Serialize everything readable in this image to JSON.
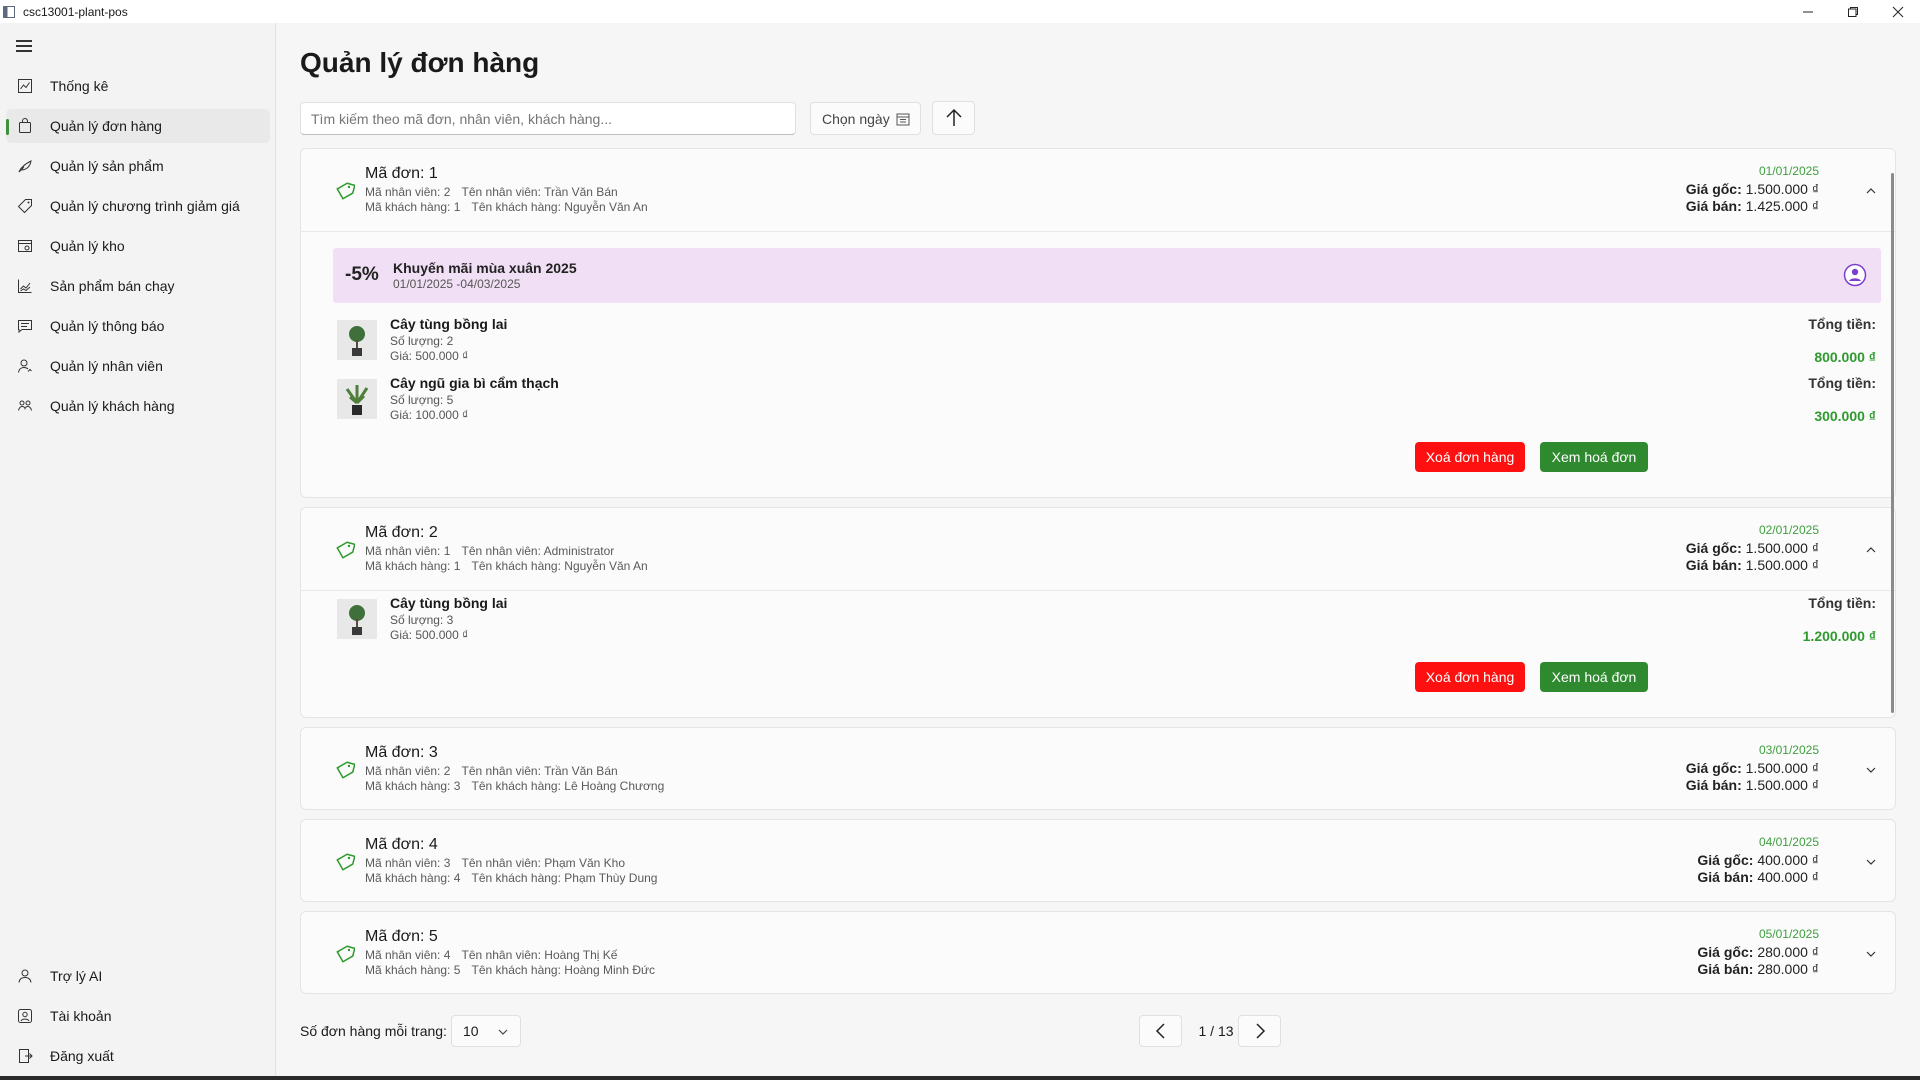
{
  "window": {
    "title": "csc13001-plant-pos"
  },
  "sidebar": {
    "items": [
      {
        "label": "Thống kê",
        "icon": "chart-icon"
      },
      {
        "label": "Quản lý đơn hàng",
        "icon": "shopping-bag-icon"
      },
      {
        "label": "Quản lý sản phẩm",
        "icon": "plant-icon"
      },
      {
        "label": "Quản lý chương trình giảm giá",
        "icon": "tag-icon"
      },
      {
        "label": "Quản lý kho",
        "icon": "warehouse-icon"
      },
      {
        "label": "Sản phẩm bán chạy",
        "icon": "trend-chart-icon"
      },
      {
        "label": "Quản lý thông báo",
        "icon": "message-icon"
      },
      {
        "label": "Quản lý nhân viên",
        "icon": "person-icon"
      },
      {
        "label": "Quản lý khách hàng",
        "icon": "people-icon"
      }
    ],
    "bottom_items": [
      {
        "label": "Trợ lý AI",
        "icon": "bot-icon"
      },
      {
        "label": "Tài khoản",
        "icon": "account-icon"
      },
      {
        "label": "Đăng xuất",
        "icon": "sign-out-icon"
      }
    ],
    "active_item": "Quản lý đơn hàng"
  },
  "main": {
    "title": "Quản lý đơn hàng",
    "search": {
      "placeholder": "Tìm kiếm theo mã đơn, nhân viên, khách hàng..."
    },
    "date_picker": {
      "label": "Chọn ngày"
    },
    "accent_color": "#2f8a2f",
    "danger_color": "#ff1010"
  },
  "labels": {
    "employee_id": "Mã nhân viên:",
    "employee_name": "Tên nhân viên:",
    "customer_id": "Mã khách hàng:",
    "customer_name": "Tên khách hàng:",
    "original_price": "Giá gốc:",
    "sale_price": "Giá bán:",
    "quantity": "Số lượng:",
    "unit_price": "Giá:",
    "total": "Tổng tiền:",
    "delete_order": "Xoá đơn hàng",
    "view_invoice": "Xem hoá đơn"
  },
  "orders": [
    {
      "id_label": "Mã đơn: 1",
      "employee_id": "2",
      "employee_name": "Trần Văn Bán",
      "customer_id": "1",
      "customer_name": "Nguyễn Văn An",
      "date": "01/01/2025",
      "original_price": "1.500.000 ₫",
      "sale_price": "1.425.000 ₫",
      "expanded": true,
      "promotion": {
        "percent": "-5%",
        "name": "Khuyến mãi mùa xuân 2025",
        "dates": "01/01/2025 -04/03/2025"
      },
      "items": [
        {
          "name": "Cây tùng bồng lai",
          "quantity": "2",
          "price": "500.000 ₫",
          "total": "800.000 ₫"
        },
        {
          "name": "Cây ngũ gia bì cẩm thạch",
          "quantity": "5",
          "price": "100.000 ₫",
          "total": "300.000 ₫"
        }
      ]
    },
    {
      "id_label": "Mã đơn: 2",
      "employee_id": "1",
      "employee_name": "Administrator",
      "customer_id": "1",
      "customer_name": "Nguyễn Văn An",
      "date": "02/01/2025",
      "original_price": "1.500.000 ₫",
      "sale_price": "1.500.000 ₫",
      "expanded": true,
      "items": [
        {
          "name": "Cây tùng bồng lai",
          "quantity": "3",
          "price": "500.000 ₫",
          "total": "1.200.000 ₫"
        }
      ]
    },
    {
      "id_label": "Mã đơn: 3",
      "employee_id": "2",
      "employee_name": "Trần Văn Bán",
      "customer_id": "3",
      "customer_name": "Lê Hoàng Chương",
      "date": "03/01/2025",
      "original_price": "1.500.000 ₫",
      "sale_price": "1.500.000 ₫",
      "expanded": false
    },
    {
      "id_label": "Mã đơn: 4",
      "employee_id": "3",
      "employee_name": "Phạm Văn Kho",
      "customer_id": "4",
      "customer_name": "Phạm Thùy Dung",
      "date": "04/01/2025",
      "original_price": "400.000 ₫",
      "sale_price": "400.000 ₫",
      "expanded": false
    },
    {
      "id_label": "Mã đơn: 5",
      "employee_id": "4",
      "employee_name": "Hoàng Thị Kế",
      "customer_id": "5",
      "customer_name": "Hoàng Minh Đức",
      "date": "05/01/2025",
      "original_price": "280.000 ₫",
      "sale_price": "280.000 ₫",
      "expanded": false
    }
  ],
  "footer": {
    "per_page_label": "Số đơn hàng mỗi trang:",
    "per_page_value": "10",
    "page_indicator": "1 / 13"
  }
}
